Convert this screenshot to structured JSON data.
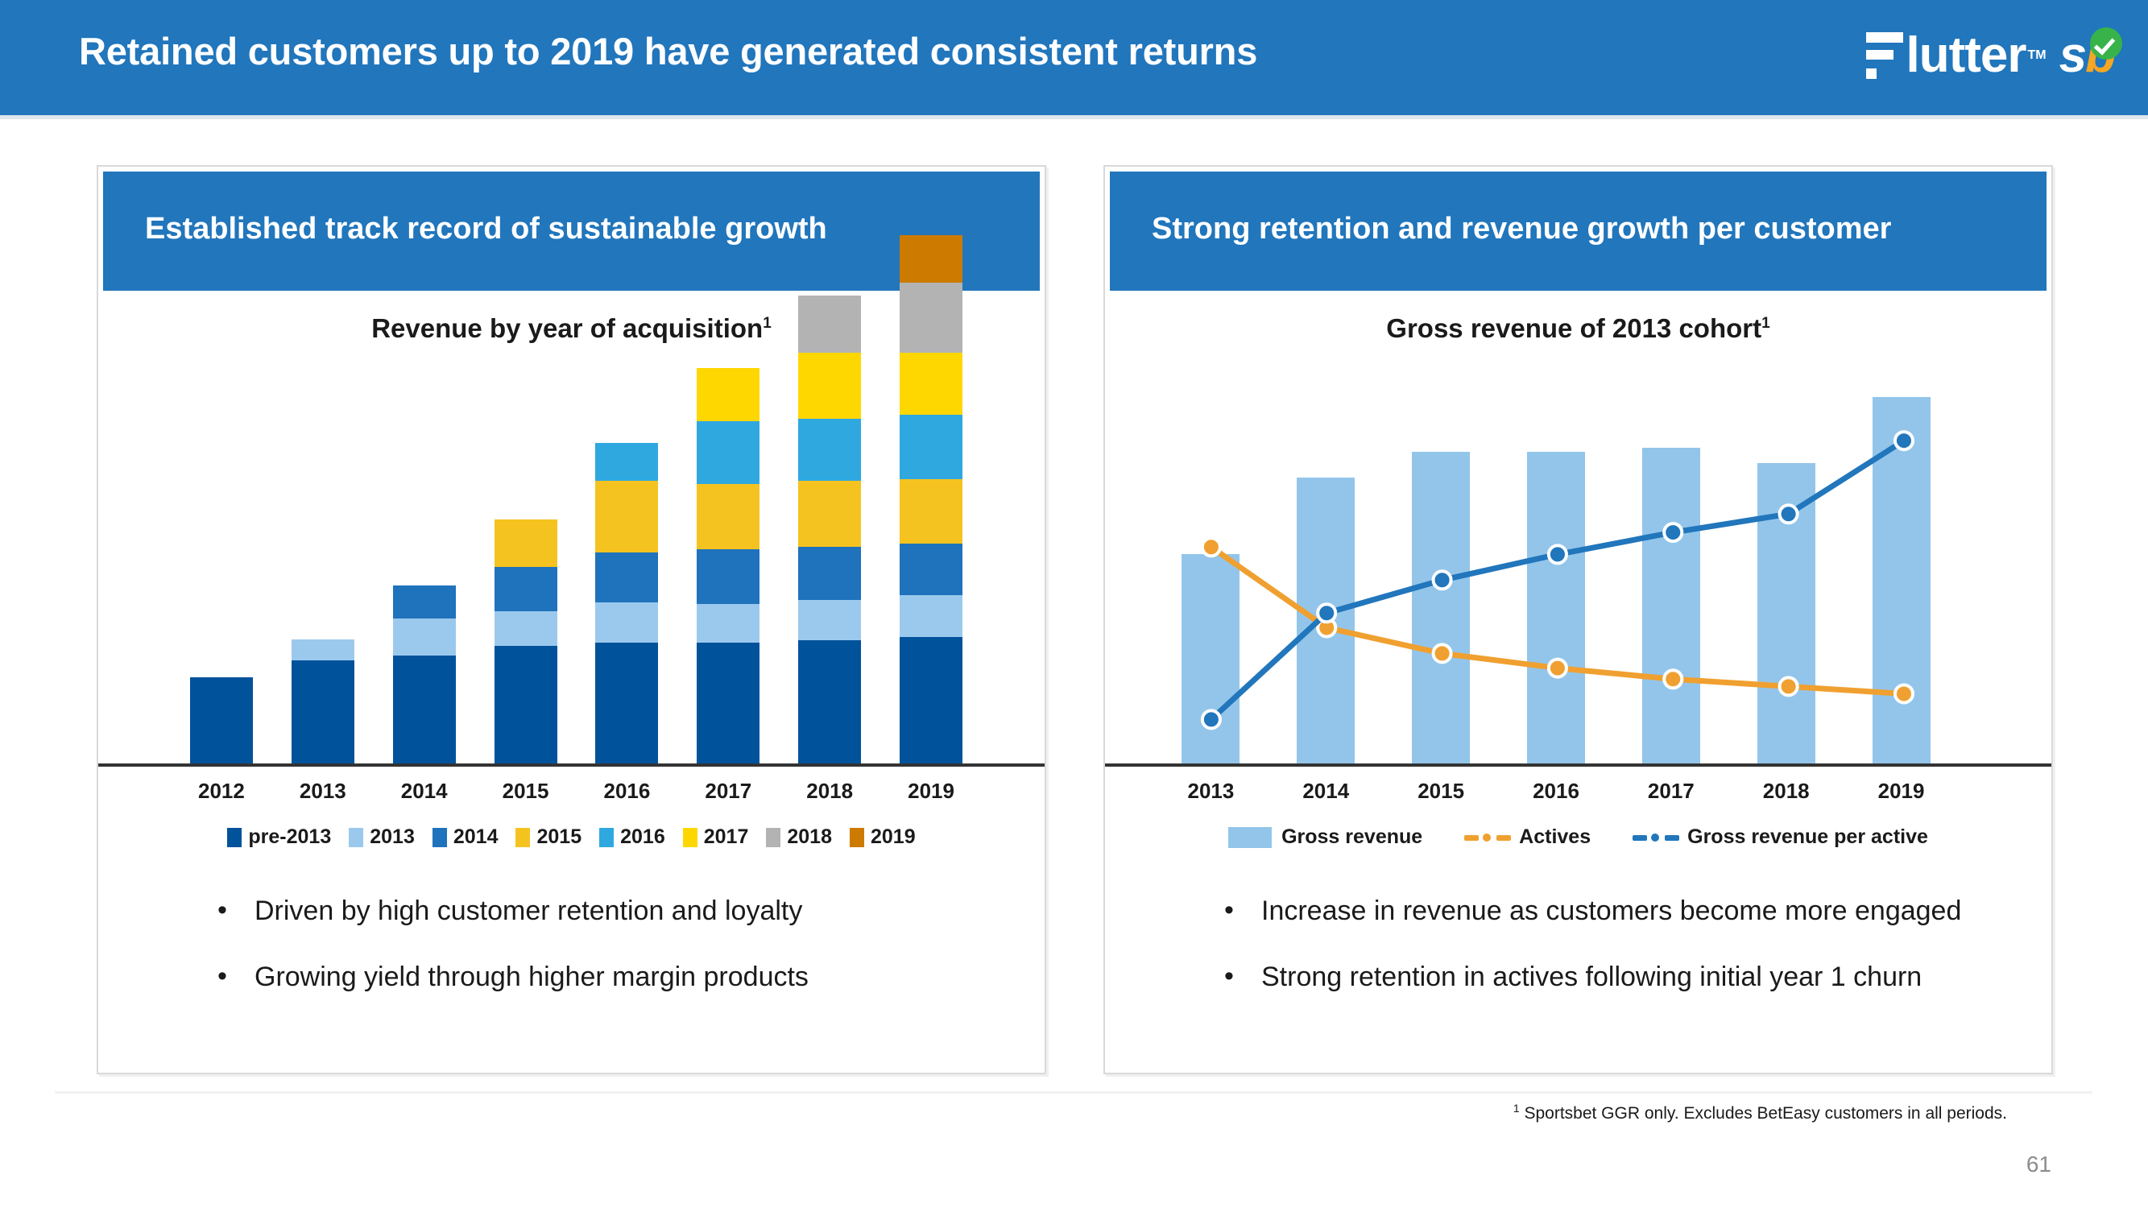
{
  "header": {
    "title": "Retained customers up to 2019 have generated consistent returns",
    "bg_color": "#2176bc",
    "logo": {
      "wordmark": "lutter",
      "tm": "TM",
      "s": "s",
      "b": "b",
      "check_icon": "check-circle-icon",
      "check_color": "#37b34a",
      "b_color": "#f5a623"
    }
  },
  "left_panel": {
    "heading": "Established track record of sustainable growth",
    "bullets": [
      "Driven by high customer retention and loyalty",
      "Growing yield through higher margin products"
    ],
    "bullet_glyph": "•"
  },
  "right_panel": {
    "heading": "Strong retention and revenue growth per customer",
    "bullets": [
      "Increase in revenue as customers become more engaged",
      "Strong retention in actives following initial year 1 churn"
    ],
    "bullet_glyph": "•"
  },
  "footer": {
    "footnote_marker": "1",
    "footnote": " Sportsbet GGR only. Excludes BetEasy customers in all periods.",
    "page_number": "61"
  },
  "chart_data": [
    {
      "id": "revenue-by-year-of-acquisition",
      "type": "bar",
      "stacked": true,
      "title": "Revenue by year of acquisition",
      "title_sup": "1",
      "xlabel": "",
      "ylabel": "",
      "grid": false,
      "axis_visible": "x-only",
      "legend_position": "bottom",
      "categories": [
        "2012",
        "2013",
        "2014",
        "2015",
        "2016",
        "2017",
        "2018",
        "2019"
      ],
      "ylim": [
        0,
        110
      ],
      "series": [
        {
          "name": "pre-2013",
          "color": "#00529b",
          "values": [
            23.6,
            28.0,
            29.5,
            32.0,
            33.0,
            33.0,
            33.5,
            34.5
          ]
        },
        {
          "name": "2013",
          "color": "#9bc9ed",
          "values": [
            0,
            5.8,
            10.0,
            9.6,
            11.0,
            10.5,
            11.0,
            11.5
          ]
        },
        {
          "name": "2014",
          "color": "#1f72bc",
          "values": [
            0,
            0,
            9.0,
            12.0,
            13.5,
            14.8,
            14.5,
            14.0
          ]
        },
        {
          "name": "2015",
          "color": "#f5c320",
          "values": [
            0,
            0,
            0,
            13.0,
            19.5,
            18.0,
            18.0,
            17.5
          ]
        },
        {
          "name": "2016",
          "color": "#2fa8e0",
          "values": [
            0,
            0,
            0,
            0,
            10.5,
            17.0,
            17.0,
            17.5
          ]
        },
        {
          "name": "2017",
          "color": "#ffd700",
          "values": [
            0,
            0,
            0,
            0,
            0,
            14.5,
            18.0,
            17.0
          ]
        },
        {
          "name": "2018",
          "color": "#b3b3b3",
          "values": [
            0,
            0,
            0,
            0,
            0,
            0,
            15.5,
            19.0
          ]
        },
        {
          "name": "2019",
          "color": "#cc7a00",
          "values": [
            0,
            0,
            0,
            0,
            0,
            0,
            0,
            13.0
          ]
        }
      ]
    },
    {
      "id": "gross-revenue-of-2013-cohort",
      "type": "bar+line",
      "title": "Gross revenue of 2013 cohort",
      "title_sup": "1",
      "xlabel": "",
      "ylabel": "",
      "grid": false,
      "axis_visible": "x-only",
      "legend_position": "bottom",
      "categories": [
        "2013",
        "2014",
        "2015",
        "2016",
        "2017",
        "2018",
        "2019"
      ],
      "ylim": [
        0,
        110
      ],
      "bar_series": {
        "name": "Gross revenue",
        "color": "#93c5ea",
        "values": [
          57,
          78,
          85,
          85,
          86,
          82,
          100
        ]
      },
      "line_series": [
        {
          "name": "Actives",
          "color": "#f0a030",
          "marker": "circle",
          "marker_ring": "#ffffff",
          "values": [
            59,
            37,
            30,
            26,
            23,
            21,
            19
          ]
        },
        {
          "name": "Gross revenue per active",
          "color": "#2176bc",
          "marker": "circle",
          "marker_ring": "#ffffff",
          "values": [
            12,
            41,
            50,
            57,
            63,
            68,
            88
          ]
        }
      ]
    }
  ]
}
